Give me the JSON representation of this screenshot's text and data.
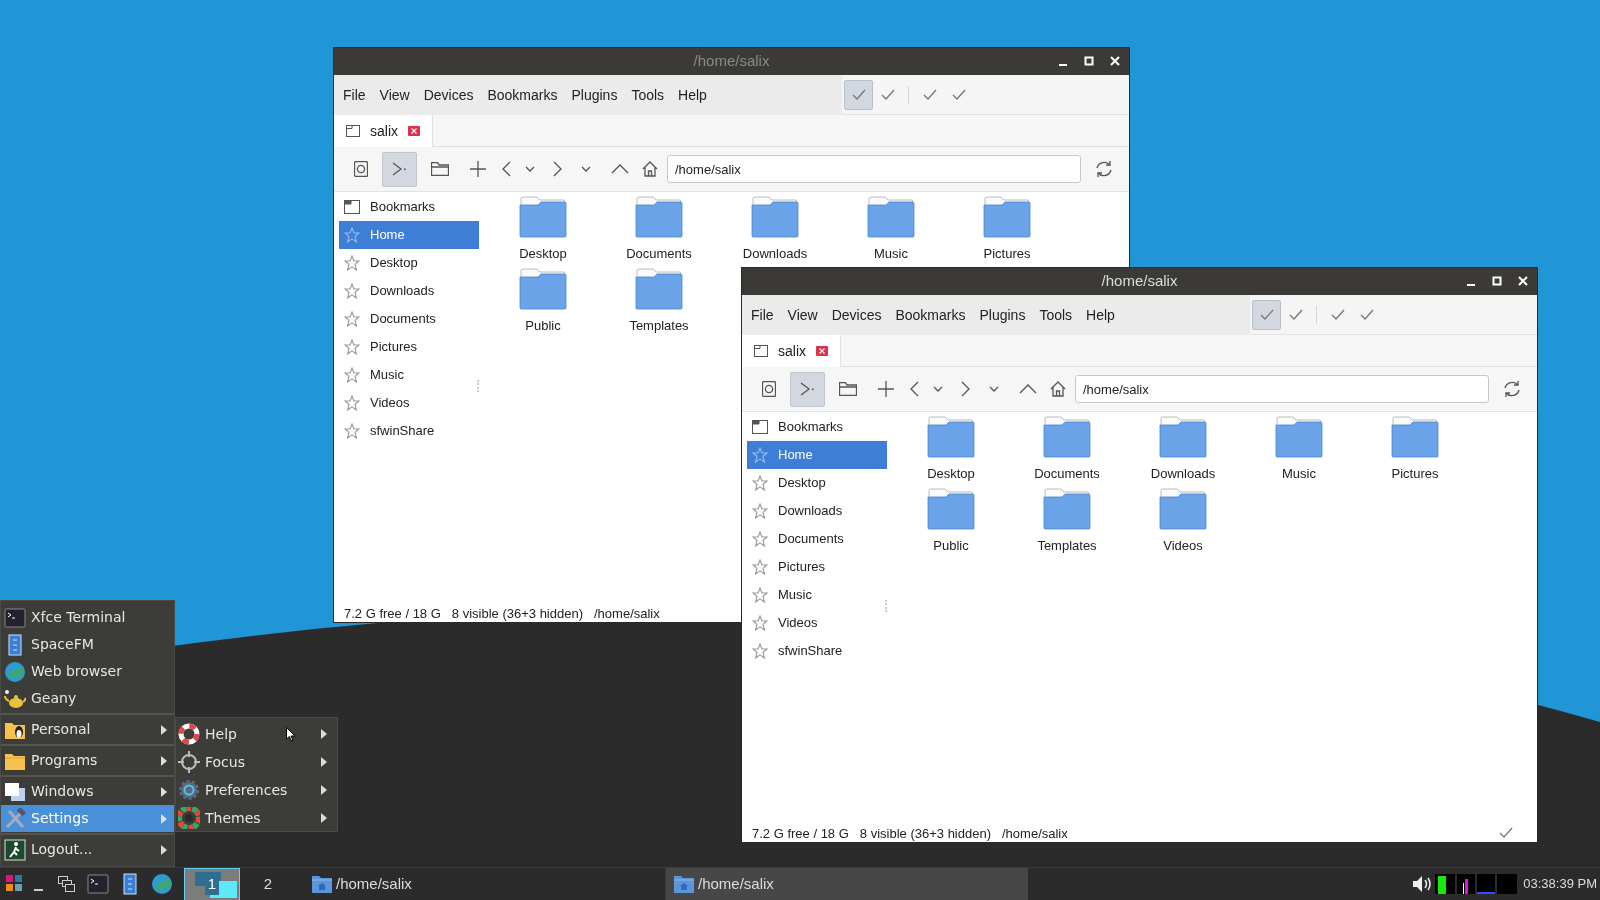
{
  "windows": [
    {
      "title": "/home/salix",
      "active": false,
      "menu": [
        "File",
        "View",
        "Devices",
        "Bookmarks",
        "Plugins",
        "Tools",
        "Help"
      ],
      "view_toggles": [
        {
          "pressed": true
        },
        {
          "pressed": false
        },
        {
          "pressed": false
        },
        {
          "pressed": false
        }
      ],
      "tabs": [
        {
          "label": "salix",
          "selected": true
        }
      ],
      "location": "/home/salix",
      "sidebar": {
        "header": "Bookmarks",
        "items": [
          {
            "label": "Home",
            "selected": true
          },
          {
            "label": "Desktop",
            "selected": false
          },
          {
            "label": "Downloads",
            "selected": false
          },
          {
            "label": "Documents",
            "selected": false
          },
          {
            "label": "Pictures",
            "selected": false
          },
          {
            "label": "Music",
            "selected": false
          },
          {
            "label": "Videos",
            "selected": false
          },
          {
            "label": "sfwinShare",
            "selected": false
          }
        ]
      },
      "files": [
        "Desktop",
        "Documents",
        "Downloads",
        "Music",
        "Pictures",
        "Public",
        "Templates"
      ],
      "status": [
        "7.2 G free / 18 G",
        "8 visible (36+3 hidden)",
        "/home/salix"
      ],
      "status_check": false
    },
    {
      "title": "/home/salix",
      "active": true,
      "menu": [
        "File",
        "View",
        "Devices",
        "Bookmarks",
        "Plugins",
        "Tools",
        "Help"
      ],
      "view_toggles": [
        {
          "pressed": true
        },
        {
          "pressed": false
        },
        {
          "pressed": false
        },
        {
          "pressed": false
        }
      ],
      "tabs": [
        {
          "label": "salix",
          "selected": true
        }
      ],
      "location": "/home/salix",
      "sidebar": {
        "header": "Bookmarks",
        "items": [
          {
            "label": "Home",
            "selected": true
          },
          {
            "label": "Desktop",
            "selected": false
          },
          {
            "label": "Downloads",
            "selected": false
          },
          {
            "label": "Documents",
            "selected": false
          },
          {
            "label": "Pictures",
            "selected": false
          },
          {
            "label": "Music",
            "selected": false
          },
          {
            "label": "Videos",
            "selected": false
          },
          {
            "label": "sfwinShare",
            "selected": false
          }
        ]
      },
      "files": [
        "Desktop",
        "Documents",
        "Downloads",
        "Music",
        "Pictures",
        "Public",
        "Templates",
        "Videos"
      ],
      "status": [
        "7.2 G free / 18 G",
        "8 visible (36+3 hidden)",
        "/home/salix"
      ],
      "status_check": true
    }
  ],
  "start_menu": {
    "sections": [
      [
        {
          "label": "Xfce Terminal",
          "submenu": false,
          "selected": false
        },
        {
          "label": "SpaceFM",
          "submenu": false,
          "selected": false
        },
        {
          "label": "Web browser",
          "submenu": false,
          "selected": false
        },
        {
          "label": "Geany",
          "submenu": false,
          "selected": false
        }
      ],
      [
        {
          "label": "Personal",
          "submenu": true,
          "selected": false
        }
      ],
      [
        {
          "label": "Programs",
          "submenu": true,
          "selected": false
        }
      ],
      [
        {
          "label": "Windows",
          "submenu": true,
          "selected": false
        },
        {
          "label": "Settings",
          "submenu": true,
          "selected": true
        }
      ],
      [
        {
          "label": "Logout...",
          "submenu": true,
          "selected": false
        }
      ]
    ],
    "submenu": [
      {
        "label": "Help"
      },
      {
        "label": "Focus"
      },
      {
        "label": "Preferences"
      },
      {
        "label": "Themes"
      }
    ]
  },
  "taskbar": {
    "workspaces": [
      {
        "label": "1",
        "selected": true
      },
      {
        "label": "2",
        "selected": false
      }
    ],
    "tasks": [
      {
        "label": "/home/salix",
        "active": false
      },
      {
        "label": "/home/salix",
        "active": true
      }
    ],
    "clock": "03:38:39 PM"
  }
}
